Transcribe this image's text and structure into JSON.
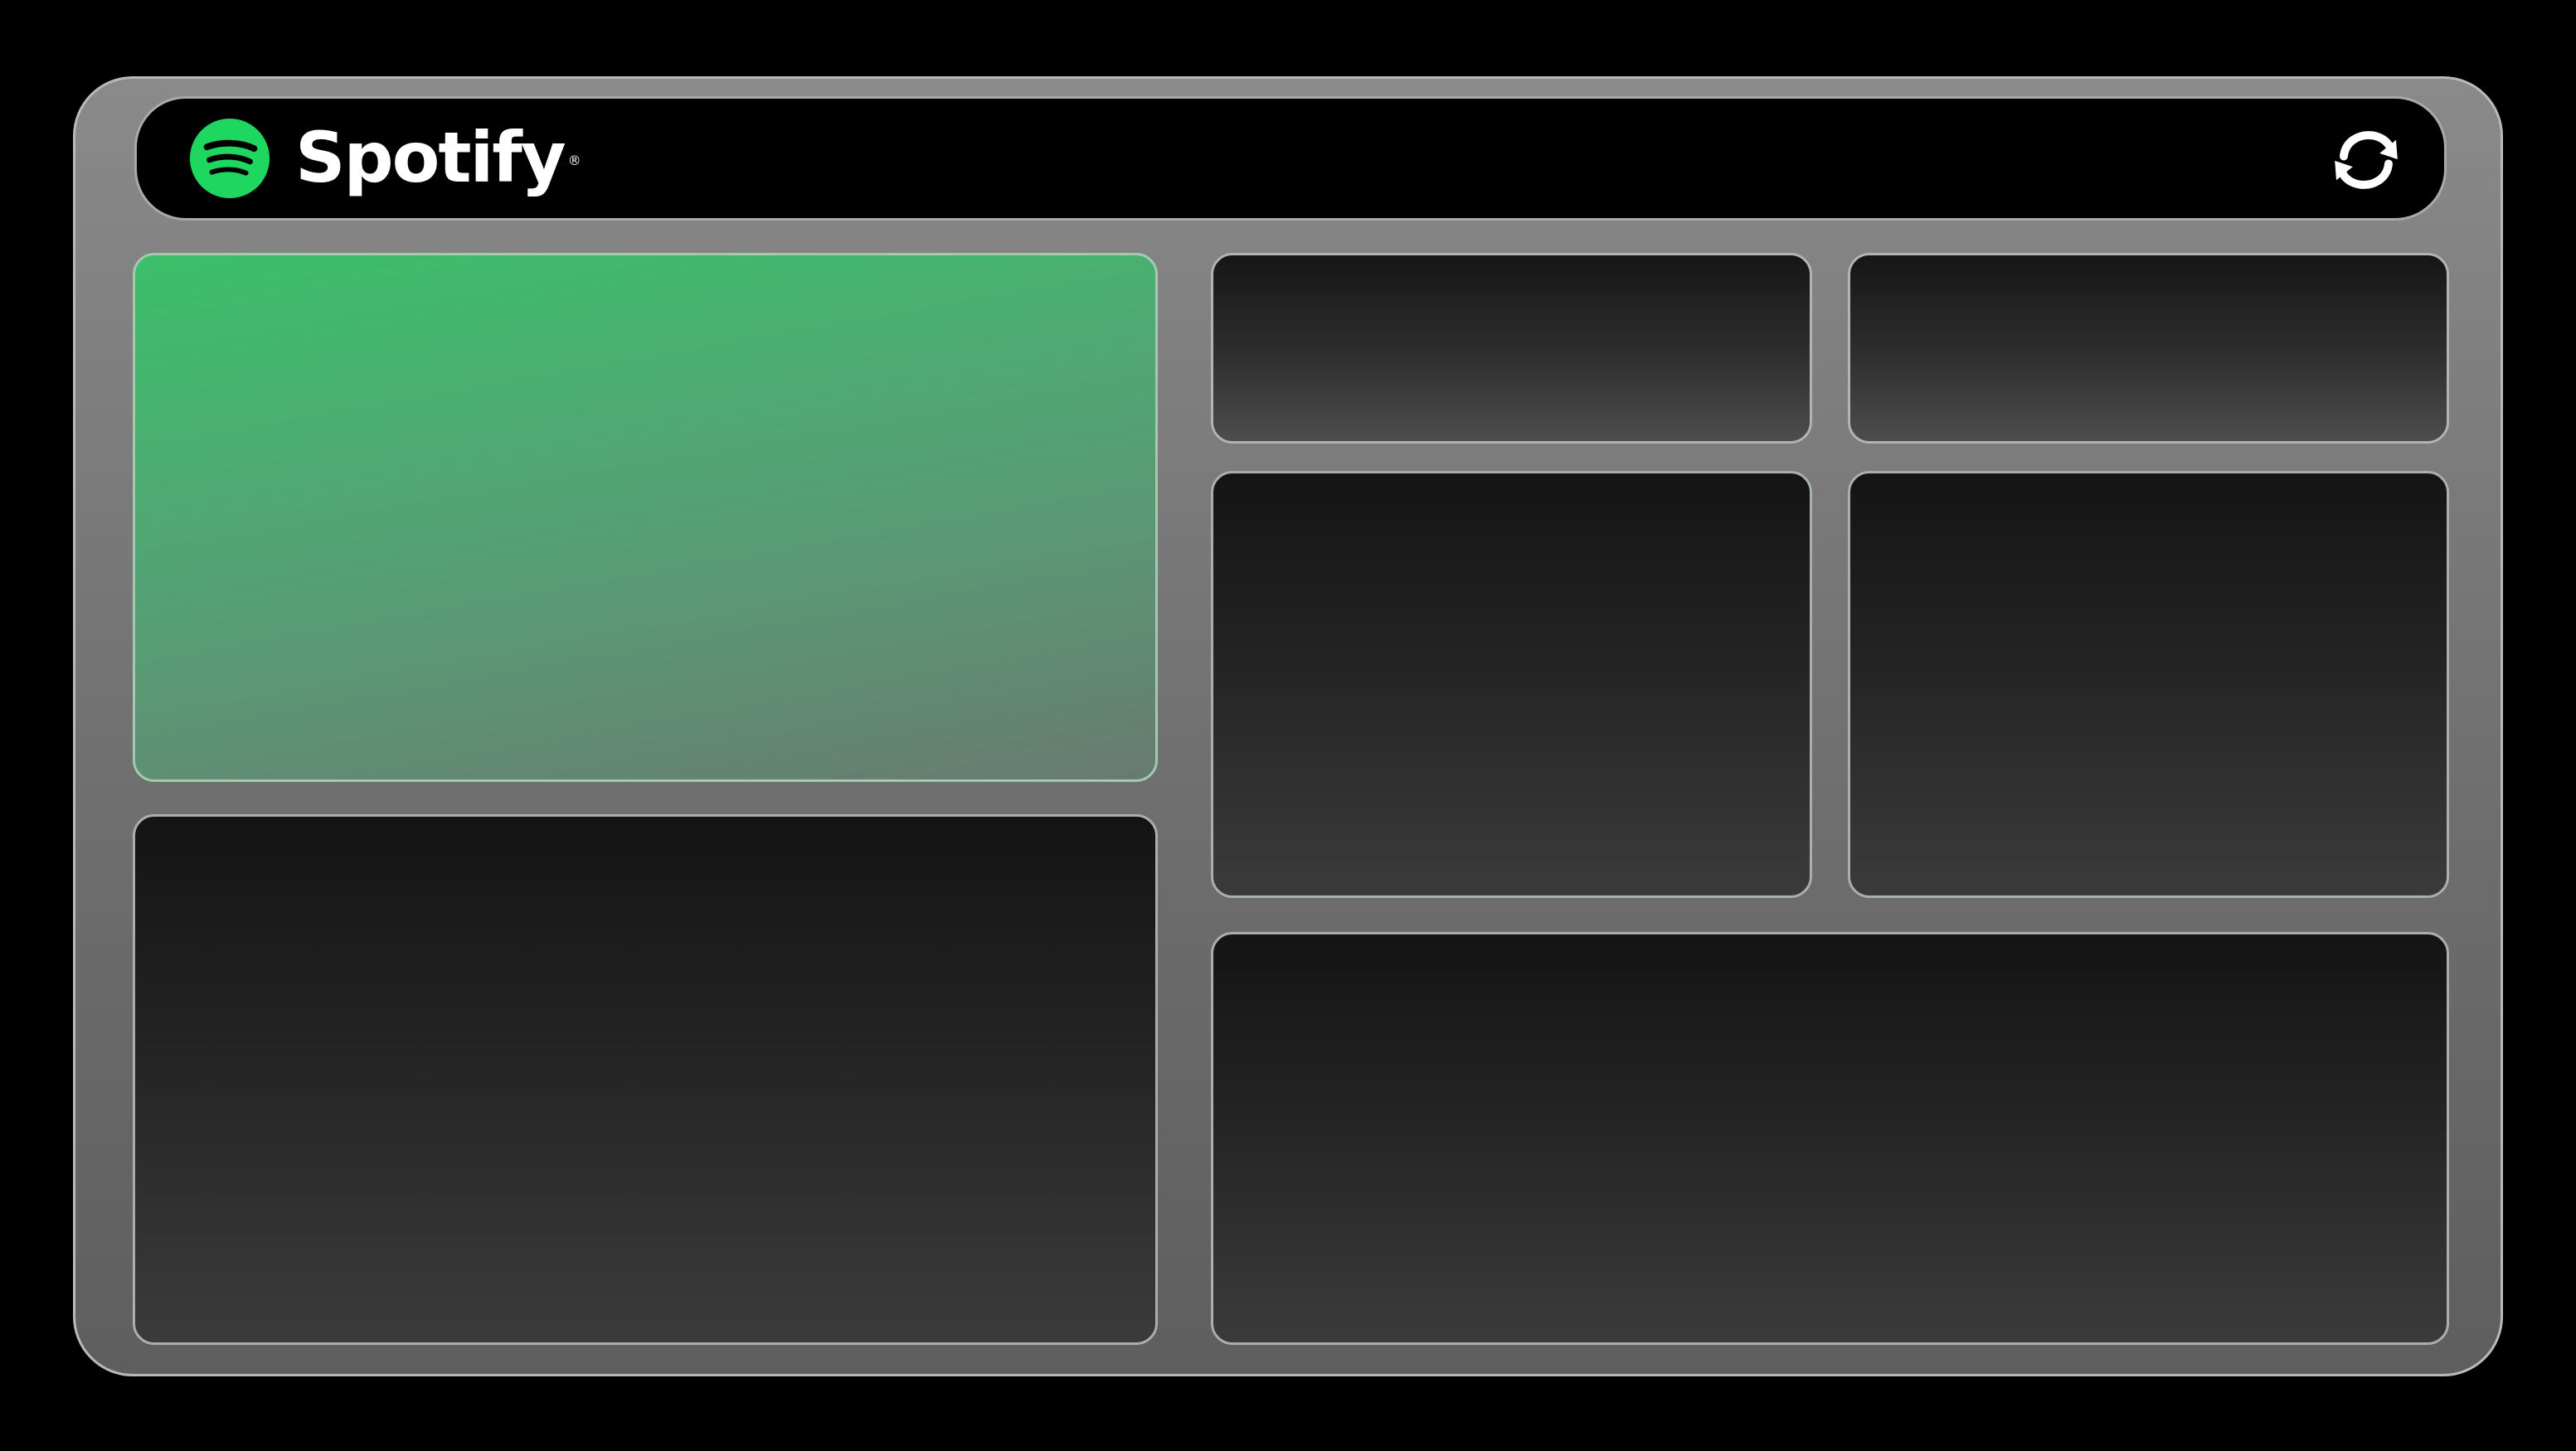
{
  "header": {
    "brand_name": "Spotify",
    "brand_mark": "®",
    "logo_icon": "spotify-logo-icon",
    "sync_icon": "sync-icon"
  },
  "colors": {
    "background": "#000000",
    "brand_green": "#1ED760",
    "frame": "#7c7c7c",
    "panel_dark": "#1e1e1e"
  }
}
